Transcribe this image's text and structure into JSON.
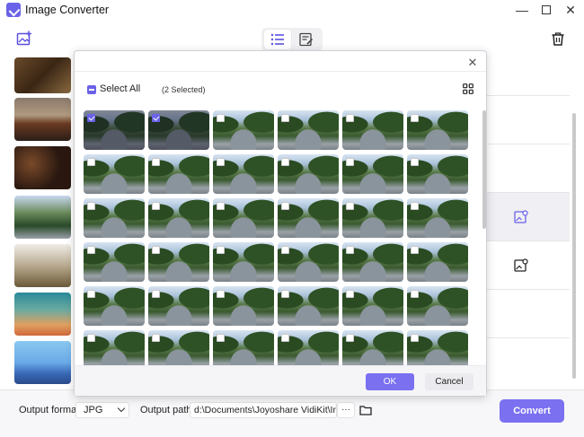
{
  "app": {
    "title": "Image Converter"
  },
  "modal": {
    "select_all_label": "Select All",
    "selected_count": "(2 Selected)",
    "ok_label": "OK",
    "cancel_label": "Cancel",
    "cells_total": 36,
    "cells_selected": [
      0,
      1
    ]
  },
  "bottom": {
    "output_format_label": "Output format:",
    "output_format_value": "JPG",
    "output_path_label": "Output path:",
    "output_path_value": "d:\\Documents\\Joyoshare VidiKit\\Image",
    "path_more": "···",
    "convert_label": "Convert"
  },
  "colors": {
    "accent": "#7a70f0",
    "accent_dark": "#6a62e8"
  }
}
